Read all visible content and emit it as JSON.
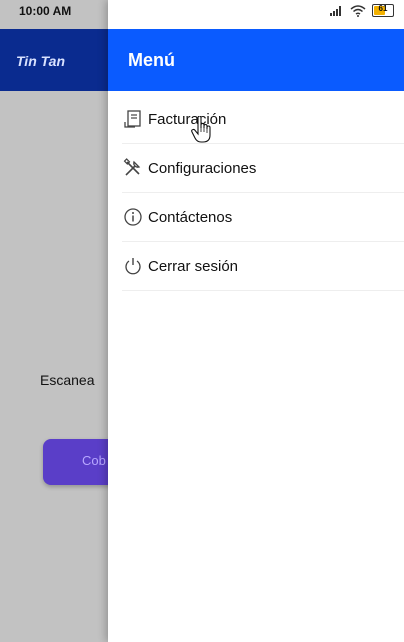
{
  "status_bar": {
    "time": "10:00 AM",
    "battery_percent": "61",
    "battery_level": 0.61
  },
  "app": {
    "title": "Tin Tan",
    "scan_text": "Escanea",
    "cobrar_button_label": "Cob"
  },
  "drawer": {
    "title": "Menú",
    "items": [
      {
        "label": "Facturación",
        "icon": "invoice-icon"
      },
      {
        "label": "Configuraciones",
        "icon": "tools-icon"
      },
      {
        "label": "Contáctenos",
        "icon": "info-icon"
      },
      {
        "label": "Cerrar sesión",
        "icon": "power-icon"
      }
    ]
  },
  "colors": {
    "drawer_header": "#0a5bff",
    "app_header": "#0a2b8f",
    "cobrar_button": "#5a3ec8",
    "dim_overlay": "#c2c2c2"
  }
}
